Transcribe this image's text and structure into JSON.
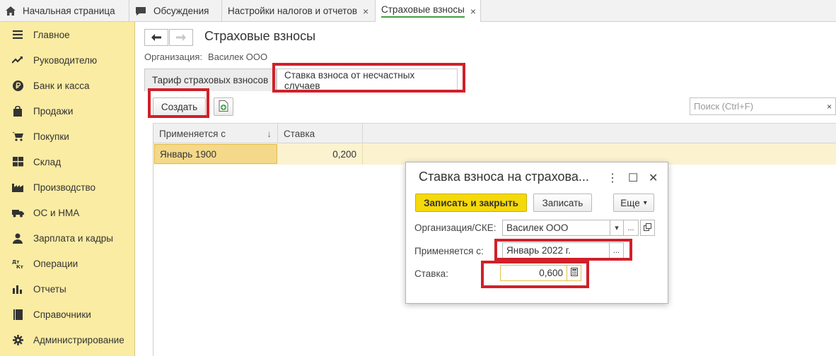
{
  "tabs": {
    "home": "Начальная страница",
    "discussions": "Обсуждения",
    "tax_settings": "Настройки налогов и отчетов",
    "insurance": "Страховые взносы",
    "close_glyph": "×"
  },
  "sidebar": {
    "items": [
      {
        "label": "Главное",
        "icon": "menu-icon"
      },
      {
        "label": "Руководителю",
        "icon": "trend-icon"
      },
      {
        "label": "Банк и касса",
        "icon": "ruble-icon"
      },
      {
        "label": "Продажи",
        "icon": "bag-icon"
      },
      {
        "label": "Покупки",
        "icon": "cart-icon"
      },
      {
        "label": "Склад",
        "icon": "warehouse-icon"
      },
      {
        "label": "Производство",
        "icon": "factory-icon"
      },
      {
        "label": "ОС и НМА",
        "icon": "truck-icon"
      },
      {
        "label": "Зарплата и кадры",
        "icon": "person-icon"
      },
      {
        "label": "Операции",
        "icon": "dt-kt-icon"
      },
      {
        "label": "Отчеты",
        "icon": "bar-chart-icon"
      },
      {
        "label": "Справочники",
        "icon": "book-icon"
      },
      {
        "label": "Администрирование",
        "icon": "gear-icon"
      }
    ]
  },
  "main": {
    "back_glyph": "🡐",
    "forward_glyph": "🡒",
    "title": "Страховые взносы",
    "org_label": "Организация:",
    "org_value": "Василек ООО",
    "subtab_tariff": "Тариф страховых взносов",
    "subtab_accident": "Ставка взноса от несчастных случаев",
    "create_label": "Создать",
    "search_placeholder": "Поиск (Ctrl+F)",
    "search_clear": "×",
    "grid": {
      "col_applies": "Применяется с",
      "sort_glyph": "↓",
      "col_rate": "Ставка",
      "row": {
        "applies": "Январь 1900",
        "rate": "0,200"
      }
    }
  },
  "dialog": {
    "title": "Ставка взноса на страхова...",
    "more_glyph": "⋮",
    "max_glyph": "☐",
    "close_glyph": "✕",
    "save_close": "Записать и закрыть",
    "save": "Записать",
    "more": "Еще",
    "org_label": "Организация/СКЕ:",
    "org_value": "Василек ООО",
    "applies_label": "Применяется с:",
    "applies_value": "Январь 2022 г.",
    "rate_label": "Ставка:",
    "rate_value": "0,600",
    "dots": "...",
    "dropdown_glyph": "▾"
  },
  "colors": {
    "sidebar_bg": "#fbeca3",
    "highlight_red": "#d0202a",
    "primary_button": "#f5d90a",
    "selected_row": "#fbf2cf"
  }
}
